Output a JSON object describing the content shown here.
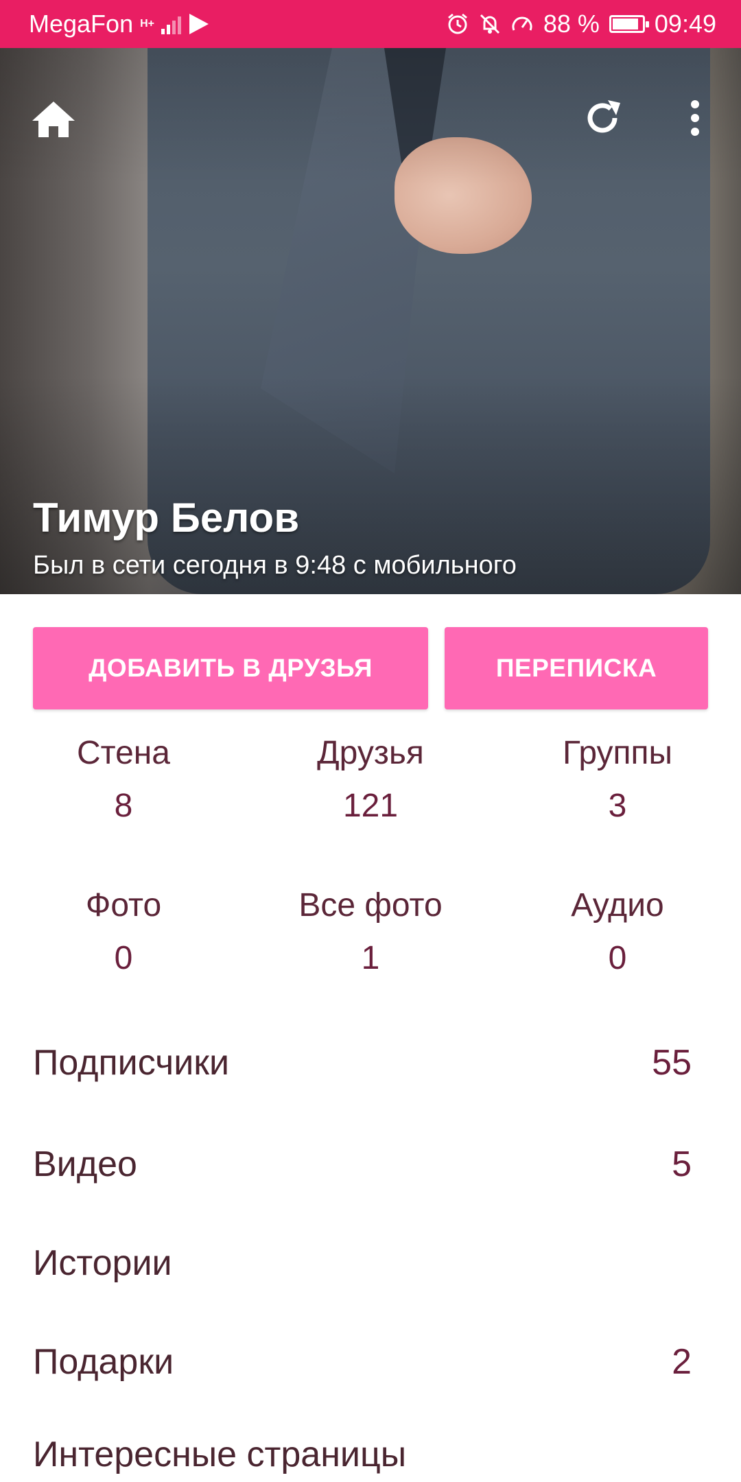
{
  "status_bar": {
    "carrier": "MegaFon",
    "net_top": "H+",
    "battery_percent": "88 %",
    "battery_level": 0.88,
    "time": "09:49"
  },
  "header": {
    "home_icon": "home-icon",
    "refresh_icon": "refresh-icon",
    "menu_icon": "more-vert-icon"
  },
  "profile": {
    "name": "Тимур Белов",
    "status": "Был в сети сегодня в 9:48 с мобильного"
  },
  "actions": {
    "add_friend": "ДОБАВИТЬ В ДРУЗЬЯ",
    "messages": "ПЕРЕПИСКА"
  },
  "stats": [
    {
      "label": "Стена",
      "value": "8"
    },
    {
      "label": "Друзья",
      "value": "121"
    },
    {
      "label": "Группы",
      "value": "3"
    },
    {
      "label": "Фото",
      "value": "0"
    },
    {
      "label": "Все фото",
      "value": "1"
    },
    {
      "label": "Аудио",
      "value": "0"
    }
  ],
  "list": [
    {
      "label": "Подписчики",
      "value": "55"
    },
    {
      "label": "Видео",
      "value": "5"
    },
    {
      "label": "Истории",
      "value": ""
    },
    {
      "label": "Подарки",
      "value": "2"
    },
    {
      "label": "Интересные страницы",
      "value": ""
    }
  ],
  "colors": {
    "status_bar": "#e91e63",
    "button": "#ff69b4",
    "stat_label": "#5b2638",
    "stat_value": "#6a1f3c"
  }
}
